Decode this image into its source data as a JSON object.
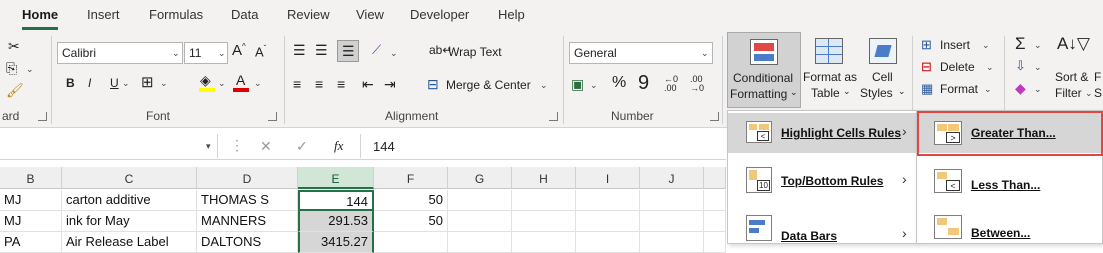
{
  "menu_tabs": [
    "Home",
    "Insert",
    "Formulas",
    "Data",
    "Review",
    "View",
    "Developer",
    "Help"
  ],
  "clipboard": {
    "label": "ard"
  },
  "font": {
    "name": "Calibri",
    "size": "11",
    "label": "Font",
    "bold": "B",
    "italic": "I",
    "underline": "U"
  },
  "alignment": {
    "wrap_text": "Wrap Text",
    "merge_center": "Merge & Center",
    "label": "Alignment"
  },
  "number": {
    "format": "General",
    "label": "Number",
    "percent": "%",
    "comma": "9"
  },
  "styles": {
    "conditional_formatting_line1": "Conditional",
    "conditional_formatting_line2": "Formatting",
    "format_as_table_line1": "Format as",
    "format_as_table_line2": "Table",
    "cell_styles_line1": "Cell",
    "cell_styles_line2": "Styles"
  },
  "cells": {
    "insert": "Insert",
    "delete": "Delete",
    "format": "Format"
  },
  "editing": {
    "sort_filter_line1": "Sort &",
    "sort_filter_line2": "Filter",
    "f_partial": "F",
    "s_partial": "S"
  },
  "formula_bar": {
    "fx": "fx",
    "value": "144"
  },
  "columns": [
    "B",
    "C",
    "D",
    "E",
    "F",
    "G",
    "H",
    "I",
    "J"
  ],
  "rows": [
    {
      "b": "MJ",
      "c": "carton additive",
      "d": "THOMAS S",
      "e": "144",
      "f": "50"
    },
    {
      "b": "MJ",
      "c": "ink for May",
      "d": "MANNERS",
      "e": "291.53",
      "f": "50"
    },
    {
      "b": "PA",
      "c": "Air Release Label",
      "d": "DALTONS",
      "e": "3415.27",
      "f": ""
    }
  ],
  "cf_menu": [
    {
      "label": "Highlight Cells Rules",
      "icon": "highlight-cells-icon"
    },
    {
      "label": "Top/Bottom Rules",
      "icon": "top-bottom-icon"
    },
    {
      "label": "Data Bars",
      "icon": "data-bars-icon"
    }
  ],
  "submenu": [
    {
      "label": "Greater Than...",
      "icon": "greater-than-icon"
    },
    {
      "label": "Less Than...",
      "icon": "less-than-icon"
    },
    {
      "label": "Between...",
      "icon": "between-icon"
    }
  ],
  "colors": {
    "accent": "#217346",
    "highlight_box": "#e04848",
    "menu_hover": "#d6d6d6"
  }
}
